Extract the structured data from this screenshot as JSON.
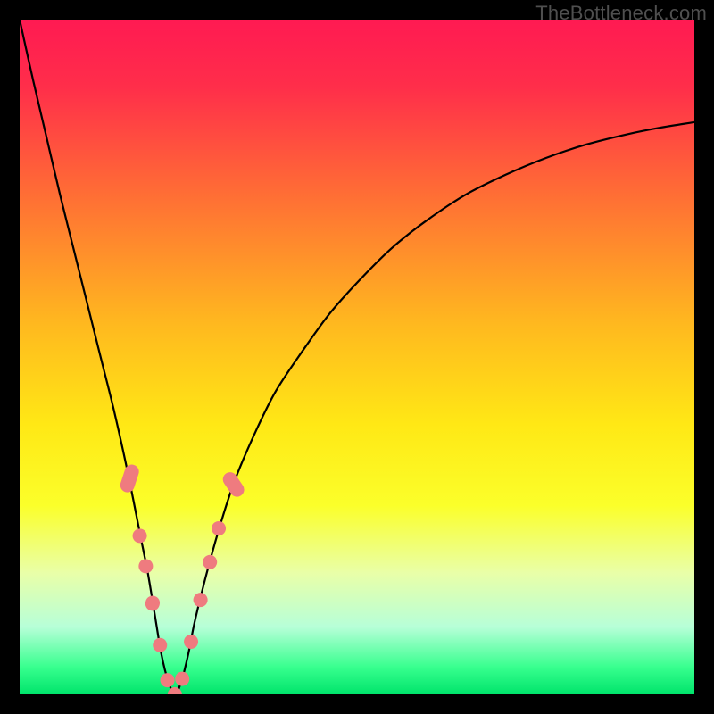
{
  "watermark": "TheBottleneck.com",
  "chart_data": {
    "type": "line",
    "title": "",
    "xlabel": "",
    "ylabel": "",
    "xlim": [
      0,
      100
    ],
    "ylim": [
      0,
      100
    ],
    "gradient_stops": [
      {
        "offset": 0,
        "color": "#ff1a52"
      },
      {
        "offset": 0.1,
        "color": "#ff2e4a"
      },
      {
        "offset": 0.25,
        "color": "#ff6a36"
      },
      {
        "offset": 0.45,
        "color": "#ffb81f"
      },
      {
        "offset": 0.6,
        "color": "#ffe815"
      },
      {
        "offset": 0.72,
        "color": "#fbff2a"
      },
      {
        "offset": 0.82,
        "color": "#e9ffa8"
      },
      {
        "offset": 0.9,
        "color": "#b7ffd8"
      },
      {
        "offset": 0.96,
        "color": "#37ff8e"
      },
      {
        "offset": 1.0,
        "color": "#00e46b"
      }
    ],
    "series": [
      {
        "name": "curve",
        "stroke": "#000000",
        "x": [
          0,
          2,
          4,
          6,
          8,
          10,
          12,
          14,
          16,
          18,
          19,
          20,
          21,
          22,
          23,
          24,
          25,
          26,
          28,
          30,
          32,
          35,
          38,
          42,
          46,
          50,
          55,
          60,
          66,
          72,
          78,
          84,
          90,
          95,
          100
        ],
        "y": [
          100,
          91,
          82.5,
          74,
          66,
          58,
          50,
          42,
          33,
          23,
          18,
          12,
          6,
          2,
          0,
          2,
          6,
          11,
          19,
          26,
          32,
          39,
          45,
          51,
          56.5,
          61,
          66,
          70,
          74,
          77,
          79.5,
          81.5,
          83,
          84,
          84.8
        ]
      }
    ],
    "markers": {
      "color": "#ef7b7f",
      "rx": 8,
      "points": [
        {
          "x": 16.3,
          "y": 32.0,
          "len": 8.5,
          "angle": -72
        },
        {
          "x": 17.8,
          "y": 23.5,
          "len": 4.0,
          "angle": -72
        },
        {
          "x": 18.7,
          "y": 19.0,
          "len": 3.0,
          "angle": -73
        },
        {
          "x": 19.7,
          "y": 13.5,
          "len": 4.5,
          "angle": -74
        },
        {
          "x": 20.8,
          "y": 7.3,
          "len": 4.0,
          "angle": -76
        },
        {
          "x": 21.9,
          "y": 2.1,
          "len": 3.5,
          "angle": -65
        },
        {
          "x": 23.0,
          "y": 0.0,
          "len": 3.0,
          "angle": 0
        },
        {
          "x": 24.1,
          "y": 2.3,
          "len": 3.5,
          "angle": 66
        },
        {
          "x": 25.4,
          "y": 7.8,
          "len": 3.5,
          "angle": 70
        },
        {
          "x": 26.8,
          "y": 14.0,
          "len": 4.0,
          "angle": 66
        },
        {
          "x": 28.2,
          "y": 19.6,
          "len": 3.5,
          "angle": 63
        },
        {
          "x": 29.5,
          "y": 24.6,
          "len": 3.5,
          "angle": 60
        },
        {
          "x": 31.7,
          "y": 31.1,
          "len": 8.0,
          "angle": 56
        }
      ]
    }
  }
}
